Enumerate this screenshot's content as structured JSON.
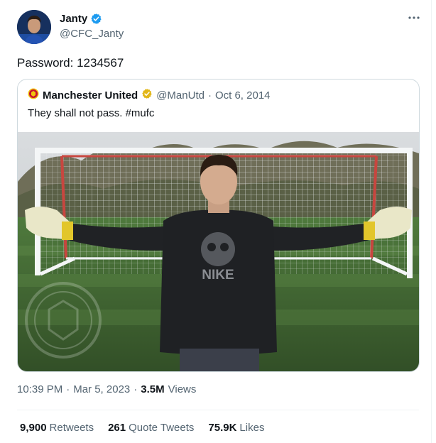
{
  "author": {
    "display_name": "Janty",
    "handle": "@CFC_Janty"
  },
  "tweet": {
    "text": "Password: 1234567",
    "time": "10:39 PM",
    "sep1": "·",
    "date": "Mar 5, 2023",
    "sep2": "·",
    "views_count": "3.5M",
    "views_label": "Views"
  },
  "quoted": {
    "display_name": "Manchester United",
    "handle": "@ManUtd",
    "sep": "·",
    "date": "Oct 6, 2014",
    "text": "They shall not pass. #mufc",
    "shirt_brand": "NIKE"
  },
  "stats": {
    "retweets_count": "9,900",
    "retweets_label": "Retweets",
    "quotes_count": "261",
    "quotes_label": "Quote Tweets",
    "likes_count": "75.9K",
    "likes_label": "Likes"
  },
  "icons": {
    "more": "more-icon",
    "verified": "verified-badge-icon",
    "club_logo": "club-crest-icon"
  },
  "colors": {
    "verified_blue": "#1d9bf0",
    "gold_badge": "#e2b719",
    "text_secondary": "#536471",
    "border": "#cfd9de"
  }
}
